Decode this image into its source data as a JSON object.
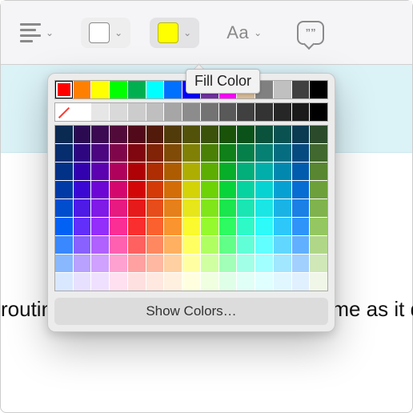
{
  "toolbar": {
    "paragraph_style": "lines",
    "border_color": "#ffffff",
    "fill_color": "#ffff00",
    "text_style_label": "Aa"
  },
  "tooltip": {
    "fill_color": "Fill Color"
  },
  "body": {
    "line": "routine. Practicing here looks the same as it does at home"
  },
  "picker": {
    "show_colors_label": "Show Colors…",
    "basic_row": [
      "#ff0000",
      "#ff8000",
      "#ffff00",
      "#00ff00",
      "#00b050",
      "#00ffff",
      "#0070ff",
      "#0000ff",
      "#7030a0",
      "#ff00ff",
      "#d4b996",
      "#808080",
      "#c0c0c0",
      "#404040",
      "#000000"
    ],
    "gray_row": [
      "none",
      "#ffffff",
      "#e6e6e6",
      "#d9d9d9",
      "#cccccc",
      "#bfbfbf",
      "#a6a6a6",
      "#8c8c8c",
      "#737373",
      "#595959",
      "#404040",
      "#333333",
      "#262626",
      "#1a1a1a",
      "#000000"
    ],
    "main_hues": [
      "#0a2a52",
      "#2b0a52",
      "#3b0a52",
      "#520a3b",
      "#520a1a",
      "#521a0a",
      "#523b0a",
      "#52520a",
      "#3b520a",
      "#1a520a",
      "#0a521a",
      "#0a523b",
      "#0a5252",
      "#0a3b52",
      "#2b4a2b"
    ],
    "main_hues_mid": [
      "#003399",
      "#3300cc",
      "#6600cc",
      "#cc0066",
      "#cc0000",
      "#cc3300",
      "#cc6600",
      "#cccc00",
      "#66cc00",
      "#00cc33",
      "#00cc99",
      "#00cccc",
      "#0099cc",
      "#0066cc",
      "#669933"
    ],
    "main_hues_bright": [
      "#0066ff",
      "#6633ff",
      "#9933ff",
      "#ff3399",
      "#ff3333",
      "#ff6633",
      "#ff9933",
      "#ffff33",
      "#99ff33",
      "#33ff66",
      "#33ffcc",
      "#33ffff",
      "#33ccff",
      "#3399ff",
      "#99cc66"
    ],
    "steps": 9
  }
}
